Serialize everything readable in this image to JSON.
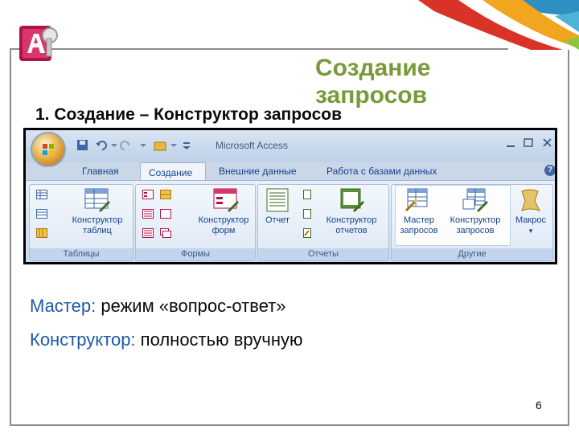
{
  "slide": {
    "title": "Создание запросов",
    "heading": "1. Создание – Конструктор запросов",
    "page_number": "6"
  },
  "ribbon": {
    "app_title": "Microsoft Access",
    "tabs": [
      "Главная",
      "Создание",
      "Внешние данные",
      "Работа с базами данных"
    ],
    "active_tab": "Создание",
    "help": "?",
    "groups": {
      "tables": {
        "label": "Таблицы",
        "button": "Конструктор таблиц"
      },
      "forms": {
        "label": "Формы",
        "button": "Конструктор форм"
      },
      "reports": {
        "label": "Отчеты",
        "report_button": "Отчет",
        "designer_button": "Конструктор отчетов"
      },
      "other": {
        "label": "Другие",
        "wizard_button": "Мастер запросов",
        "designer_button": "Конструктор запросов",
        "macro_button": "Макрос"
      }
    }
  },
  "body": {
    "line1_key": "Мастер:",
    "line1_text": " режим «вопрос-ответ»",
    "line2_key": "Конструктор:",
    "line2_text": " полностью вручную"
  },
  "colors": {
    "title_green": "#7a9a3a",
    "key_blue": "#1e5aa8",
    "ribbon_blue": "#15428b"
  }
}
